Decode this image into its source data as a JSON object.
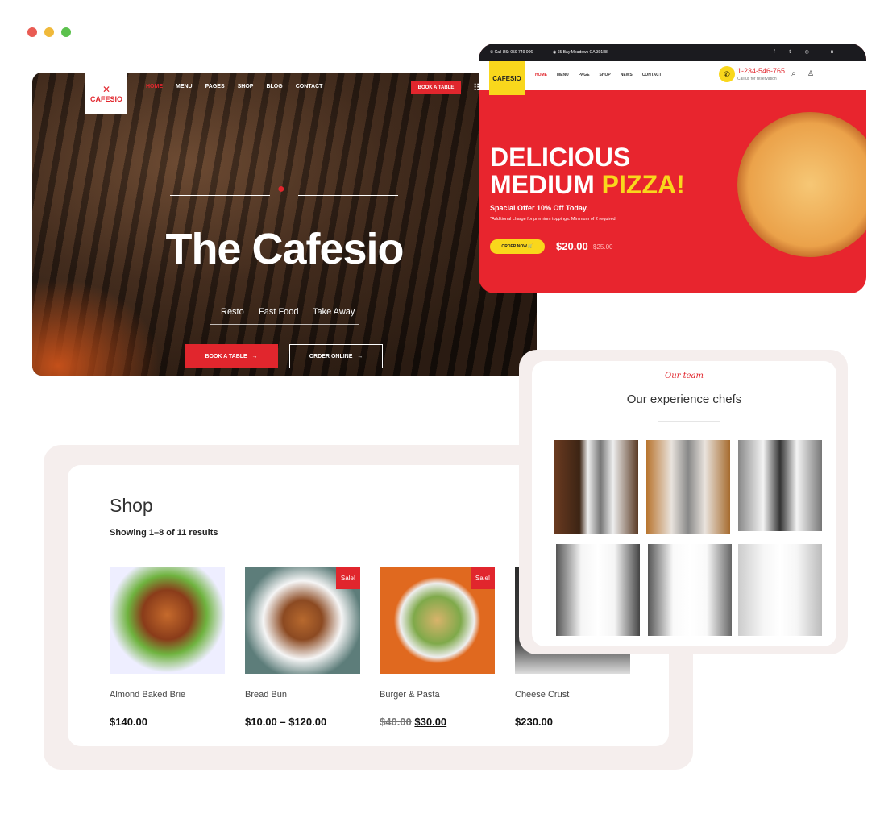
{
  "colors": {
    "accent": "#e1262d",
    "yellow": "#f9d71c",
    "dark": "#1b1b1f"
  },
  "window_dots": [
    "close",
    "minimize",
    "maximize"
  ],
  "hero": {
    "logo": "CAFESIO",
    "nav": [
      "HOME",
      "MENU",
      "PAGES",
      "SHOP",
      "BLOG",
      "CONTACT"
    ],
    "book_button": "BOOK A TABLE",
    "title": "The Cafesio",
    "subtitles": [
      "Resto",
      "Fast Food",
      "Take Away"
    ],
    "cta_book": "BOOK A TABLE",
    "cta_order": "ORDER ONLINE"
  },
  "pizza": {
    "topbar_call": "Call US: 059 749 006",
    "topbar_address": "65 Bay Meadows GA 30188",
    "social": [
      "facebook-icon",
      "twitter-icon",
      "instagram-icon",
      "linkedin-icon"
    ],
    "logo": "CAFESIO",
    "nav": [
      "HOME",
      "MENU",
      "PAGE",
      "SHOP",
      "NEWS",
      "CONTACT"
    ],
    "phone": "1-234-546-765",
    "phone_caption": "Call us for reservation",
    "headline_1": "DELICIOUS",
    "headline_2": "MEDIUM",
    "headline_3": "PIZZA!",
    "offer": "Spacial Offer 10% Off Today.",
    "note": "*Additional charge for premium toppings. Minimum of 2 required",
    "order_button": "ORDER NOW",
    "price": "$20.00",
    "old_price": "$25.00"
  },
  "shop": {
    "title": "Shop",
    "result_count": "Showing 1–8 of 11 results",
    "products": [
      {
        "name": "Almond Baked Brie",
        "price": "$140.00",
        "old_price": "",
        "sale": ""
      },
      {
        "name": "Bread Bun",
        "price": "$10.00 – $120.00",
        "old_price": "",
        "sale": "Sale!"
      },
      {
        "name": "Burger & Pasta",
        "price": "$30.00",
        "old_price": "$40.00",
        "sale": "Sale!"
      },
      {
        "name": "Cheese Crust",
        "price": "$230.00",
        "old_price": "",
        "sale": ""
      }
    ]
  },
  "team": {
    "eyebrow": "Our team",
    "title": "Our experience chefs"
  }
}
